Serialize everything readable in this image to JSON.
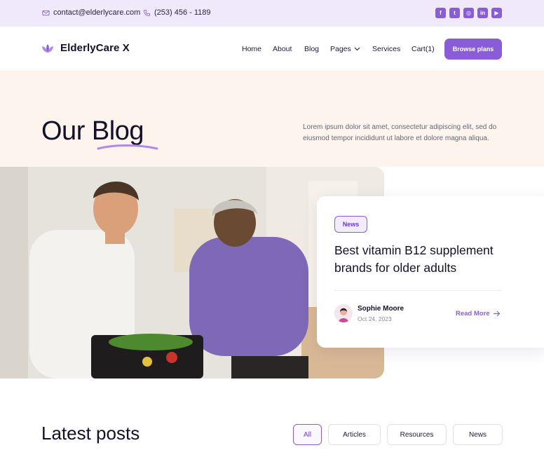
{
  "topbar": {
    "email": "contact@elderlycare.com",
    "phone": "(253) 456 - 1189",
    "socials": [
      {
        "icon": "facebook-icon",
        "glyph": "f"
      },
      {
        "icon": "twitter-icon",
        "glyph": "t"
      },
      {
        "icon": "instagram-icon",
        "glyph": "◎"
      },
      {
        "icon": "linkedin-icon",
        "glyph": "in"
      },
      {
        "icon": "youtube-icon",
        "glyph": "▶"
      }
    ]
  },
  "nav": {
    "brand": "ElderlyCare X",
    "items": [
      "Home",
      "About",
      "Blog",
      "Pages",
      "Services",
      "Cart(1)"
    ],
    "cta": "Browse plans"
  },
  "hero": {
    "title": "Our Blog",
    "description": "Lorem ipsum dolor sit amet, consectetur adipiscing elit, sed do eiusmod tempor incididunt ut labore et dolore magna aliqua."
  },
  "featured": {
    "tag": "News",
    "title": "Best vitamin B12 supplement brands for older adults",
    "author": "Sophie Moore",
    "date": "Oct 24, 2023",
    "read_more": "Read More"
  },
  "latest": {
    "title": "Latest posts",
    "filters": [
      "All",
      "Articles",
      "Resources",
      "News"
    ],
    "active_filter": "All"
  },
  "colors": {
    "accent": "#8a5cd8",
    "topbar_bg": "#efe9fb",
    "hero_bg": "#fdf4ee"
  }
}
